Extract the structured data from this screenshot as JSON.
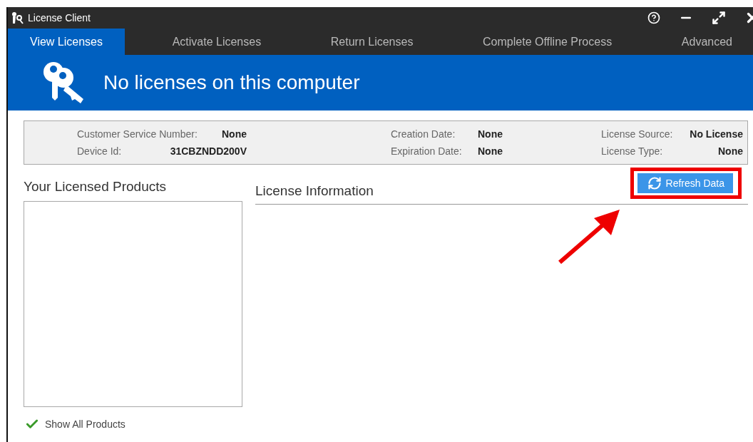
{
  "window": {
    "title": "License Client"
  },
  "tabs": [
    {
      "label": "View Licenses",
      "selected": true
    },
    {
      "label": "Activate Licenses",
      "selected": false
    },
    {
      "label": "Return Licenses",
      "selected": false
    },
    {
      "label": "Complete Offline Process",
      "selected": false
    },
    {
      "label": "Advanced",
      "selected": false
    }
  ],
  "header": {
    "message": "No licenses on this computer"
  },
  "summary": {
    "columns": [
      {
        "fields": [
          {
            "label": "Customer Service Number:",
            "value": "None"
          },
          {
            "label": "Device Id:",
            "value": "31CBZNDD200V"
          }
        ]
      },
      {
        "fields": [
          {
            "label": "Creation Date:",
            "value": "None"
          },
          {
            "label": "Expiration Date:",
            "value": "None"
          }
        ]
      },
      {
        "fields": [
          {
            "label": "License Source:",
            "value": "No License"
          },
          {
            "label": "License Type:",
            "value": "None"
          }
        ]
      }
    ]
  },
  "products": {
    "title": "Your Licensed Products",
    "show_all": {
      "label": "Show All Products",
      "checked": true
    }
  },
  "license_info": {
    "title": "License Information",
    "refresh_button": "Refresh Data"
  }
}
